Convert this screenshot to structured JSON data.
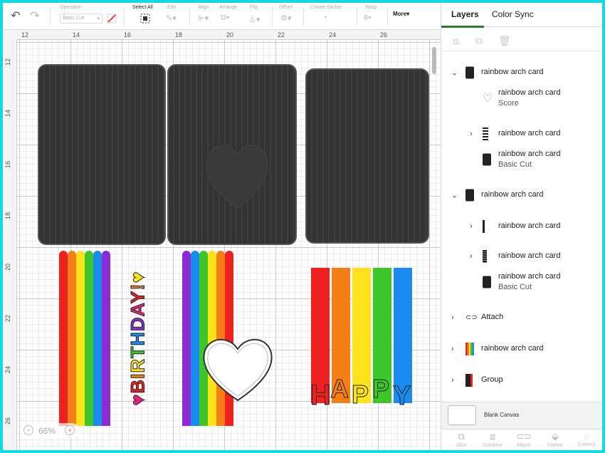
{
  "toolbar": {
    "operation_label": "Operation",
    "operation_value": "Basic Cut",
    "select_all_label": "Select All",
    "edit_label": "Edit",
    "align_label": "Align",
    "arrange_label": "Arrange",
    "flip_label": "Flip",
    "offset_label": "Offset",
    "create_sticker_label": "Create Sticker",
    "warp_label": "Warp",
    "more_label": "More"
  },
  "ruler": {
    "top_ticks": [
      "12",
      "14",
      "16",
      "18",
      "20",
      "22",
      "24",
      "26"
    ],
    "left_ticks": [
      "12",
      "14",
      "16",
      "18",
      "20",
      "22",
      "24",
      "26"
    ]
  },
  "canvas": {
    "birthday_text": "♥BIRTHDAY!♥",
    "happy_letters": [
      "H",
      "A",
      "P",
      "P",
      "Y"
    ],
    "zoom": "66%",
    "zoom_out": "−",
    "zoom_in": "+"
  },
  "colors": {
    "red": "#ee2020",
    "orange": "#f57f17",
    "yellow": "#ffe31a",
    "green": "#3cc62a",
    "blue": "#1a8cf0",
    "purple": "#8c2bd6",
    "pink": "#e8247a",
    "card_dark": "#333333",
    "selected_tab": "#2c7a38"
  },
  "panel": {
    "tabs": [
      "Layers",
      "Color Sync"
    ],
    "layers": [
      {
        "label": "rainbow arch card",
        "expander": "⌄",
        "thumb": "black"
      },
      {
        "label": "rainbow arch card",
        "sub": "Score",
        "thumb": "dashed-heart"
      },
      {
        "label": "rainbow arch card",
        "expander": "›",
        "thumb": "stripes"
      },
      {
        "label": "rainbow arch card",
        "sub": "Basic Cut",
        "thumb": "black"
      },
      {
        "label": "rainbow arch card",
        "expander": "⌄",
        "thumb": "black"
      },
      {
        "label": "rainbow arch card",
        "expander": "›",
        "thumb": "line"
      },
      {
        "label": "rainbow arch card",
        "expander": "›",
        "thumb": "line2"
      },
      {
        "label": "rainbow arch card",
        "sub": "Basic Cut",
        "thumb": "black"
      },
      {
        "label": "Attach",
        "expander": "›",
        "thumb": "attach"
      },
      {
        "label": "rainbow arch card",
        "expander": "›",
        "thumb": "rainbow"
      },
      {
        "label": "Group",
        "expander": "›",
        "thumb": "group"
      }
    ],
    "blank_canvas_label": "Blank Canvas",
    "bottom_actions": [
      "Slice",
      "Combine",
      "Attach",
      "Flatten",
      "Contour"
    ]
  }
}
